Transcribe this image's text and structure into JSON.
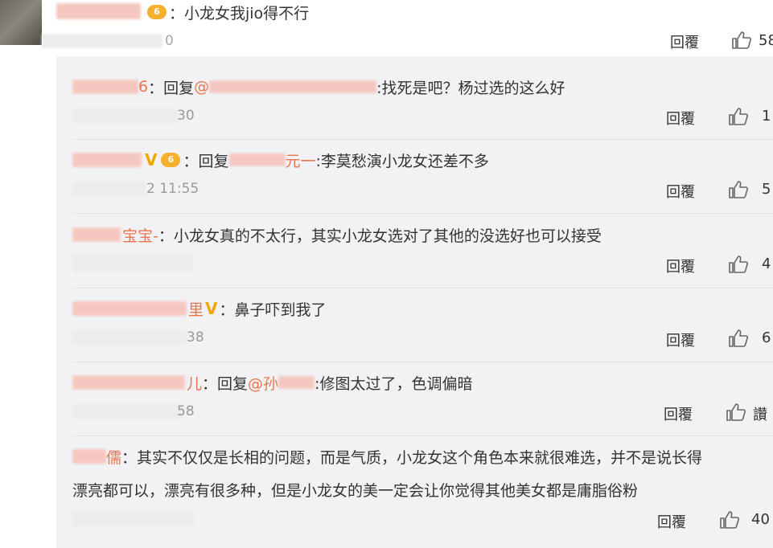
{
  "top_comment": {
    "name_tail": "",
    "text": "：小龙女我jio得不行",
    "time_tail": "0",
    "reply_label": "回覆",
    "likes": "58"
  },
  "replies": [
    {
      "name_tail": "6",
      "sep": "：回复",
      "mention_prefix": "@",
      "text": ":找死是吧？杨过选的这么好",
      "time_tail": "30",
      "reply_label": "回覆",
      "likes": "1"
    },
    {
      "name_tail": "",
      "sep": "：回复",
      "mention_prefix": "",
      "mention_tail": "元一",
      "text": ":李莫愁演小龙女还差不多",
      "time_tail": "2 11:55",
      "reply_label": "回覆",
      "likes": "5"
    },
    {
      "name_tail": "宝宝-",
      "text": "：小龙女真的不太行，其实小龙女选对了其他的没选好也可以接受",
      "time_tail": "",
      "reply_label": "回覆",
      "likes": "4"
    },
    {
      "name_tail": "里",
      "text": "：鼻子吓到我了",
      "time_tail": "38",
      "reply_label": "回覆",
      "likes": "6"
    },
    {
      "name_tail": "儿",
      "sep": "：回复",
      "mention_prefix": "@孙",
      "text": ":修图太过了，色调偏暗",
      "time_tail": "58",
      "reply_label": "回覆",
      "likes": "讚"
    },
    {
      "name_tail": "儒",
      "text": "：其实不仅仅是长相的问题，而是气质，小龙女这个角色本来就很难选，并不是说长得",
      "text2": "漂亮都可以，漂亮有很多种，但是小龙女的美一定会让你觉得其他美女都是庸脂俗粉",
      "time_tail": "",
      "reply_label": "回覆",
      "likes": "40"
    }
  ],
  "colors": {
    "link": "#eb7350",
    "panel_bg": "#f2f2f5",
    "text": "#333333",
    "time": "#999999",
    "vip_badge": "#f5b12d",
    "verified_v": "#f0a800"
  },
  "icons": {
    "like": "thumbs-up-icon",
    "verified": "verified-v-icon",
    "vip": "vip-level-icon"
  },
  "vip_level": "6"
}
